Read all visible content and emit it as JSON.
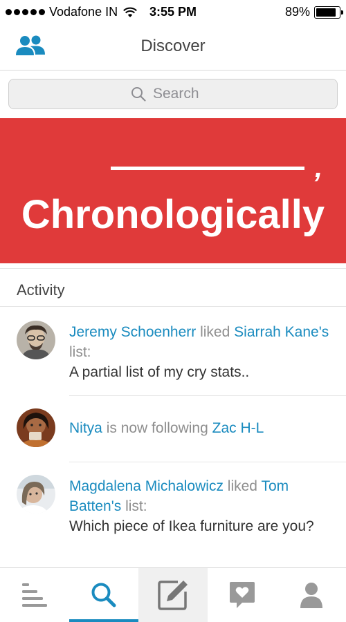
{
  "status_bar": {
    "carrier": "Vodafone IN",
    "time": "3:55 PM",
    "battery": "89%",
    "battery_level": 0.89
  },
  "nav": {
    "title": "Discover"
  },
  "search": {
    "placeholder": "Search"
  },
  "banner": {
    "text": "Chronologically",
    "comma": ","
  },
  "activity": {
    "title": "Activity",
    "items": [
      {
        "user": "Jeremy Schoenherr",
        "action": "liked",
        "target": "Siarrah Kane's",
        "suffix": "list:",
        "list_title": "A partial list of my cry stats.."
      },
      {
        "user": "Nitya",
        "action": "is now following",
        "target": "Zac H-L"
      },
      {
        "user": "Magdalena Michalowicz",
        "action": "liked",
        "target": "Tom Batten's",
        "suffix": "list:",
        "list_title": "Which piece of Ikea furniture are you?"
      }
    ]
  },
  "tabs": [
    {
      "name": "feed-icon"
    },
    {
      "name": "search-icon",
      "active": true
    },
    {
      "name": "compose-icon"
    },
    {
      "name": "heart-message-icon"
    },
    {
      "name": "profile-icon"
    }
  ],
  "colors": {
    "accent": "#1a8bbf",
    "banner": "#e03a3a",
    "icon_gray": "#999999"
  }
}
